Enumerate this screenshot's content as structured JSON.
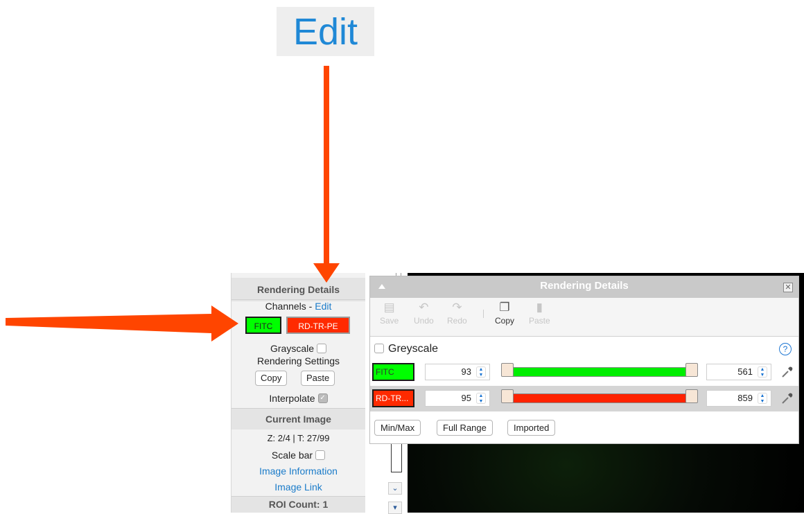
{
  "zoom_callout": {
    "label": "Edit"
  },
  "left_panel": {
    "rendering_header": "Rendering Details",
    "channels_label": "Channels - ",
    "channels_edit_link": "Edit",
    "channel_buttons": [
      {
        "label": "FITC",
        "color": "#00ff00"
      },
      {
        "label": "RD-TR-PE",
        "color": "#ff2a00"
      }
    ],
    "grayscale_label": "Grayscale",
    "rendering_settings_label": "Rendering Settings",
    "copy_label": "Copy",
    "paste_label": "Paste",
    "interpolate_label": "Interpolate",
    "current_image_header": "Current Image",
    "z_t_text": "Z: 2/4 | T: 27/99",
    "scale_bar_label": "Scale bar",
    "image_information_link": "Image Information",
    "image_link": "Image Link",
    "roi_count": "ROI Count: 1"
  },
  "dialog": {
    "title": "Rendering Details",
    "toolbar": [
      {
        "label": "Save",
        "icon": "save-icon",
        "enabled": false
      },
      {
        "label": "Undo",
        "icon": "undo-icon",
        "enabled": false
      },
      {
        "label": "Redo",
        "icon": "redo-icon",
        "enabled": false
      },
      {
        "label": "Copy",
        "icon": "copy-icon",
        "enabled": true
      },
      {
        "label": "Paste",
        "icon": "paste-icon",
        "enabled": false
      }
    ],
    "greyscale_label": "Greyscale",
    "help_icon_glyph": "?",
    "channels": [
      {
        "label": "FITC",
        "color": "#00ff00",
        "min": "93",
        "max": "561"
      },
      {
        "label": "RD-TR...",
        "color": "#ff2a00",
        "min": "95",
        "max": "859"
      }
    ],
    "buttons": {
      "min_max": "Min/Max",
      "full_range": "Full Range",
      "imported": "Imported"
    }
  },
  "annotation_color": "#ff4500"
}
